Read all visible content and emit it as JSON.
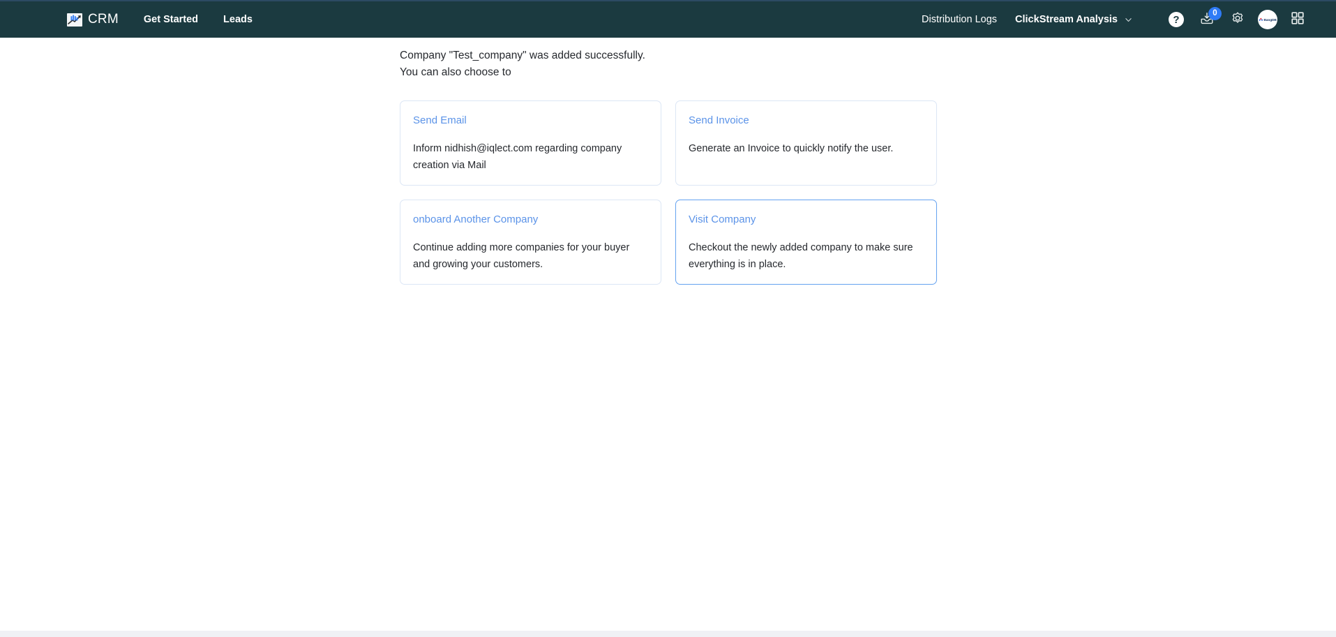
{
  "navbar": {
    "brand": {
      "logo_icon": "chart-arrow-logo-icon",
      "name": "CRM"
    },
    "left_links": [
      {
        "label": "Get Started",
        "name": "nav-link-get-started"
      },
      {
        "label": "Leads",
        "name": "nav-link-leads"
      }
    ],
    "right_link": {
      "label": "Distribution Logs",
      "name": "nav-link-distribution-logs"
    },
    "dropdown": {
      "label": "ClickStream Analysis",
      "chevron_icon": "chevron-down-icon"
    },
    "icons": {
      "help": {
        "glyph": "?",
        "name": "help-icon"
      },
      "inbox": {
        "name": "inbox-download-icon",
        "badge_count": "0"
      },
      "settings": {
        "name": "gear-icon"
      },
      "apps": {
        "name": "apps-grid-icon"
      }
    },
    "avatar": {
      "name": "avatar",
      "text": "BangDB"
    },
    "colors": {
      "navbar_bg": "#1b3a40",
      "navbar_top_border": "#2c4a63",
      "badge_bg": "#2f7bf6"
    }
  },
  "main": {
    "message": {
      "line1": "Company \"Test_company\" was added successfully.",
      "line2": "You can also choose to"
    },
    "cards": [
      {
        "name": "card-send-email",
        "title": "Send Email",
        "body": "Inform nidhish@iqlect.com regarding company creation via Mail",
        "highlighted": false
      },
      {
        "name": "card-send-invoice",
        "title": "Send Invoice",
        "body": "Generate an Invoice to quickly notify the user.",
        "highlighted": false
      },
      {
        "name": "card-onboard-another-company",
        "title": "onboard Another Company",
        "body": "Continue adding more companies for your buyer and growing your customers.",
        "highlighted": false
      },
      {
        "name": "card-visit-company",
        "title": "Visit Company",
        "body": "Checkout the newly added company to make sure everything is in place.",
        "highlighted": true
      }
    ],
    "colors": {
      "card_border": "#dce6f5",
      "card_border_highlight": "#64a2f0",
      "link_text": "#5b93e8",
      "body_text": "#26292e",
      "page_bg": "#ffffff",
      "bottom_strip": "#f0f1f5"
    }
  }
}
